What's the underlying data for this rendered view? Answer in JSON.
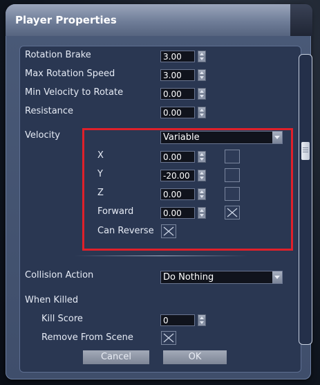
{
  "window": {
    "title": "Player Properties"
  },
  "fields": {
    "rotation_brake": {
      "label": "Rotation Brake",
      "value": "3.00"
    },
    "max_rotation_speed": {
      "label": "Max Rotation Speed",
      "value": "3.00"
    },
    "min_velocity_to_rotate": {
      "label": "Min Velocity to Rotate",
      "value": "0.00"
    },
    "resistance": {
      "label": "Resistance",
      "value": "0.00"
    }
  },
  "velocity": {
    "label": "Velocity",
    "mode": "Variable",
    "x": {
      "label": "X",
      "value": "0.00"
    },
    "y": {
      "label": "Y",
      "value": "-20.00"
    },
    "z": {
      "label": "Z",
      "value": "0.00"
    },
    "forward": {
      "label": "Forward",
      "value": "0.00",
      "checked": true
    },
    "can_reverse": {
      "label": "Can Reverse",
      "checked": true
    }
  },
  "collision": {
    "label": "Collision Action",
    "value": "Do Nothing"
  },
  "when_killed": {
    "label": "When Killed",
    "kill_score": {
      "label": "Kill Score",
      "value": "0"
    },
    "remove_from_scene": {
      "label": "Remove From Scene",
      "checked": true
    }
  },
  "buttons": {
    "cancel": "Cancel",
    "ok": "OK"
  },
  "colors": {
    "highlight": "#e0202a",
    "panel": "#2a3752",
    "window": "#4a5a78"
  },
  "icons": [
    "spin-up-down-icon",
    "dropdown-arrow-icon",
    "checkbox-x-icon",
    "scroll-thumb-grip-icon"
  ]
}
